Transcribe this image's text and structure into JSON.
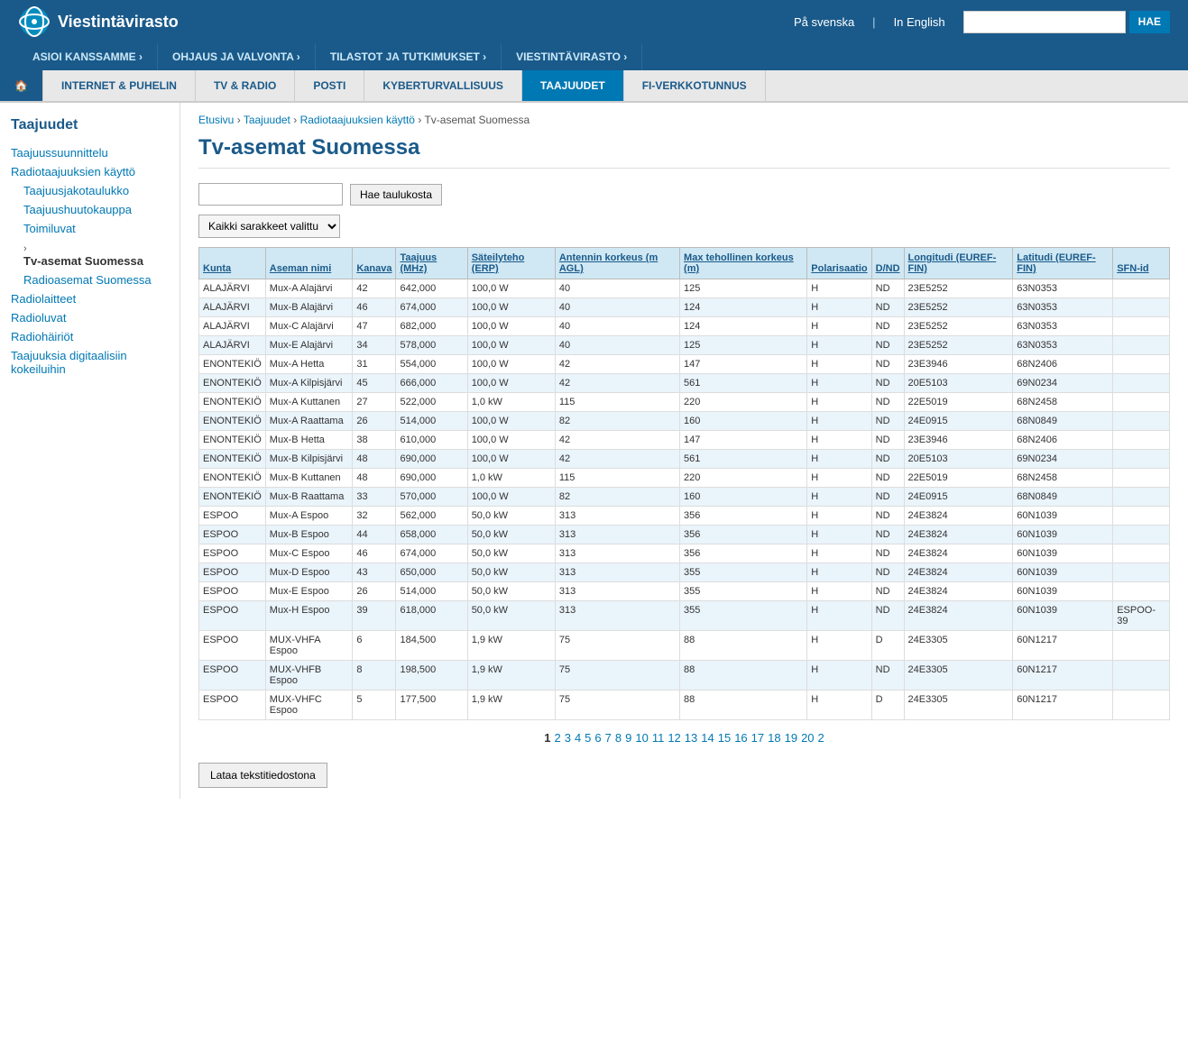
{
  "site": {
    "logo_text": "Viestintävirasto",
    "lang_sv": "På svenska",
    "lang_en": "In English",
    "search_placeholder": "",
    "search_btn": "HAE"
  },
  "main_nav": [
    {
      "label": "ASIOI KANSSAMME ›"
    },
    {
      "label": "OHJAUS JA VALVONTA ›"
    },
    {
      "label": "TILASTOT JA TUTKIMUKSET ›"
    },
    {
      "label": "VIESTINTÄVIRASTO ›"
    }
  ],
  "tabs": [
    {
      "label": "🏠",
      "id": "home"
    },
    {
      "label": "INTERNET & PUHELIN",
      "id": "internet"
    },
    {
      "label": "TV & RADIO",
      "id": "tv"
    },
    {
      "label": "POSTI",
      "id": "posti"
    },
    {
      "label": "KYBERTURVALLISUUS",
      "id": "kyber"
    },
    {
      "label": "TAAJUUDET",
      "id": "taajuudet",
      "active": true
    },
    {
      "label": "FI-VERKKOTUNNUS",
      "id": "fi"
    }
  ],
  "sidebar": {
    "title": "Taajuudet",
    "links": [
      {
        "label": "Taajuussuunnittelu",
        "href": "#"
      },
      {
        "label": "Radiotaajuuksien käyttö",
        "href": "#"
      },
      {
        "label": "Taajuusjakotaulukko",
        "href": "#",
        "sub": true
      },
      {
        "label": "Taajuushuutokauppa",
        "href": "#",
        "sub": true
      },
      {
        "label": "Toimiluvat",
        "href": "#",
        "sub": true
      },
      {
        "label": "Tv-asemat Suomessa",
        "href": "#",
        "sub": true,
        "active": true
      },
      {
        "label": "Radioasemat Suomessa",
        "href": "#",
        "sub": true
      },
      {
        "label": "Radiolaitteet",
        "href": "#"
      },
      {
        "label": "Radioluvat",
        "href": "#"
      },
      {
        "label": "Radiohäiriöt",
        "href": "#"
      },
      {
        "label": "Taajuuksia digitaalisiin kokeiluihin",
        "href": "#"
      }
    ]
  },
  "breadcrumb": {
    "items": [
      "Etusivu",
      "Taajuudet",
      "Radiotaajuuksien käyttö",
      "Tv-asemat Suomessa"
    ]
  },
  "page": {
    "title": "Tv-asemat Suomessa",
    "search_placeholder": "",
    "search_btn": "Hae taulukosta",
    "col_select_label": "Kaikki sarakkeet valittu"
  },
  "table": {
    "headers": [
      "Kunta",
      "Aseman nimi",
      "Kanava",
      "Taajuus (MHz)",
      "Säteilyteho (ERP)",
      "Antennin korkeus (m AGL)",
      "Max tehollinen korkeus (m)",
      "Polarisaatio",
      "D/ND",
      "Longitudi (EUREF-FIN)",
      "Latitudi (EUREF-FIN)",
      "SFN-id"
    ],
    "rows": [
      [
        "ALAJÄRVI",
        "Mux-A Alajärvi",
        "42",
        "642,000",
        "100,0 W",
        "40",
        "125",
        "H",
        "ND",
        "23E5252",
        "63N0353",
        ""
      ],
      [
        "ALAJÄRVI",
        "Mux-B Alajärvi",
        "46",
        "674,000",
        "100,0 W",
        "40",
        "124",
        "H",
        "ND",
        "23E5252",
        "63N0353",
        ""
      ],
      [
        "ALAJÄRVI",
        "Mux-C Alajärvi",
        "47",
        "682,000",
        "100,0 W",
        "40",
        "124",
        "H",
        "ND",
        "23E5252",
        "63N0353",
        ""
      ],
      [
        "ALAJÄRVI",
        "Mux-E Alajärvi",
        "34",
        "578,000",
        "100,0 W",
        "40",
        "125",
        "H",
        "ND",
        "23E5252",
        "63N0353",
        ""
      ],
      [
        "ENONTEKIÖ",
        "Mux-A Hetta",
        "31",
        "554,000",
        "100,0 W",
        "42",
        "147",
        "H",
        "ND",
        "23E3946",
        "68N2406",
        ""
      ],
      [
        "ENONTEKIÖ",
        "Mux-A Kilpisjärvi",
        "45",
        "666,000",
        "100,0 W",
        "42",
        "561",
        "H",
        "ND",
        "20E5103",
        "69N0234",
        ""
      ],
      [
        "ENONTEKIÖ",
        "Mux-A Kuttanen",
        "27",
        "522,000",
        "1,0 kW",
        "115",
        "220",
        "H",
        "ND",
        "22E5019",
        "68N2458",
        ""
      ],
      [
        "ENONTEKIÖ",
        "Mux-A Raattama",
        "26",
        "514,000",
        "100,0 W",
        "82",
        "160",
        "H",
        "ND",
        "24E0915",
        "68N0849",
        ""
      ],
      [
        "ENONTEKIÖ",
        "Mux-B Hetta",
        "38",
        "610,000",
        "100,0 W",
        "42",
        "147",
        "H",
        "ND",
        "23E3946",
        "68N2406",
        ""
      ],
      [
        "ENONTEKIÖ",
        "Mux-B Kilpisjärvi",
        "48",
        "690,000",
        "100,0 W",
        "42",
        "561",
        "H",
        "ND",
        "20E5103",
        "69N0234",
        ""
      ],
      [
        "ENONTEKIÖ",
        "Mux-B Kuttanen",
        "48",
        "690,000",
        "1,0 kW",
        "115",
        "220",
        "H",
        "ND",
        "22E5019",
        "68N2458",
        ""
      ],
      [
        "ENONTEKIÖ",
        "Mux-B Raattama",
        "33",
        "570,000",
        "100,0 W",
        "82",
        "160",
        "H",
        "ND",
        "24E0915",
        "68N0849",
        ""
      ],
      [
        "ESPOO",
        "Mux-A Espoo",
        "32",
        "562,000",
        "50,0 kW",
        "313",
        "356",
        "H",
        "ND",
        "24E3824",
        "60N1039",
        ""
      ],
      [
        "ESPOO",
        "Mux-B Espoo",
        "44",
        "658,000",
        "50,0 kW",
        "313",
        "356",
        "H",
        "ND",
        "24E3824",
        "60N1039",
        ""
      ],
      [
        "ESPOO",
        "Mux-C Espoo",
        "46",
        "674,000",
        "50,0 kW",
        "313",
        "356",
        "H",
        "ND",
        "24E3824",
        "60N1039",
        ""
      ],
      [
        "ESPOO",
        "Mux-D Espoo",
        "43",
        "650,000",
        "50,0 kW",
        "313",
        "355",
        "H",
        "ND",
        "24E3824",
        "60N1039",
        ""
      ],
      [
        "ESPOO",
        "Mux-E Espoo",
        "26",
        "514,000",
        "50,0 kW",
        "313",
        "355",
        "H",
        "ND",
        "24E3824",
        "60N1039",
        ""
      ],
      [
        "ESPOO",
        "Mux-H Espoo",
        "39",
        "618,000",
        "50,0 kW",
        "313",
        "355",
        "H",
        "ND",
        "24E3824",
        "60N1039",
        "ESPOO-39"
      ],
      [
        "ESPOO",
        "MUX-VHFA Espoo",
        "6",
        "184,500",
        "1,9 kW",
        "75",
        "88",
        "H",
        "D",
        "24E3305",
        "60N1217",
        ""
      ],
      [
        "ESPOO",
        "MUX-VHFB Espoo",
        "8",
        "198,500",
        "1,9 kW",
        "75",
        "88",
        "H",
        "ND",
        "24E3305",
        "60N1217",
        ""
      ],
      [
        "ESPOO",
        "MUX-VHFC Espoo",
        "5",
        "177,500",
        "1,9 kW",
        "75",
        "88",
        "H",
        "D",
        "24E3305",
        "60N1217",
        ""
      ]
    ]
  },
  "pagination": {
    "current": "1",
    "pages": [
      "1",
      "2",
      "3",
      "4",
      "5",
      "6",
      "7",
      "8",
      "9",
      "10",
      "11",
      "12",
      "13",
      "14",
      "15",
      "16",
      "17",
      "18",
      "19",
      "20",
      "2"
    ]
  },
  "download_btn": "Lataa tekstitiedostona"
}
